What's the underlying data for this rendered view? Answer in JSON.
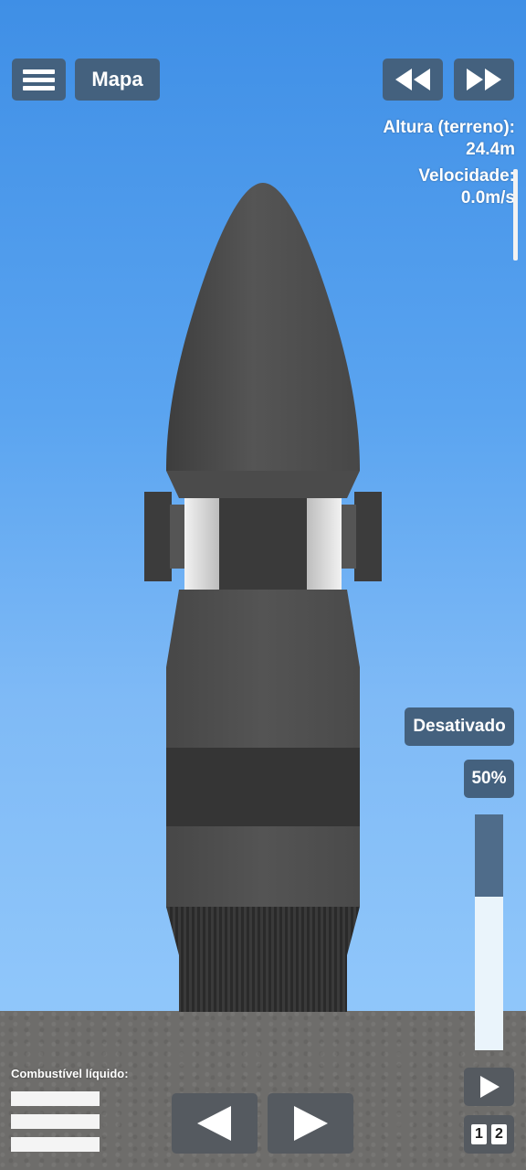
{
  "toolbar": {
    "menu_icon": "hamburger-icon",
    "map_label": "Mapa",
    "rewind_icon": "rewind-icon",
    "fast_forward_icon": "fast-forward-icon"
  },
  "flight_info": {
    "altitude_label": "Altura (terreno):",
    "altitude_value": "24.4m",
    "velocity_label": "Velocidade:",
    "velocity_value": "0.0m/s"
  },
  "throttle": {
    "status_label": "Desativado",
    "percent_label": "50%",
    "fill_fraction": 0.35
  },
  "fuel": {
    "label": "Combustível líquido:"
  },
  "controls": {
    "rotate_left_icon": "triangle-left-icon",
    "rotate_right_icon": "triangle-right-icon",
    "stage_icon": "play-icon",
    "stage_numbers": [
      "1",
      "2"
    ]
  },
  "colors": {
    "sky_top": "#3f8fe6",
    "sky_bottom": "#93c9fb",
    "ground": "#6e6d6b",
    "ui_button": "#44617e",
    "control_button": "#555a60",
    "rocket_body": "#4e4e4e"
  }
}
